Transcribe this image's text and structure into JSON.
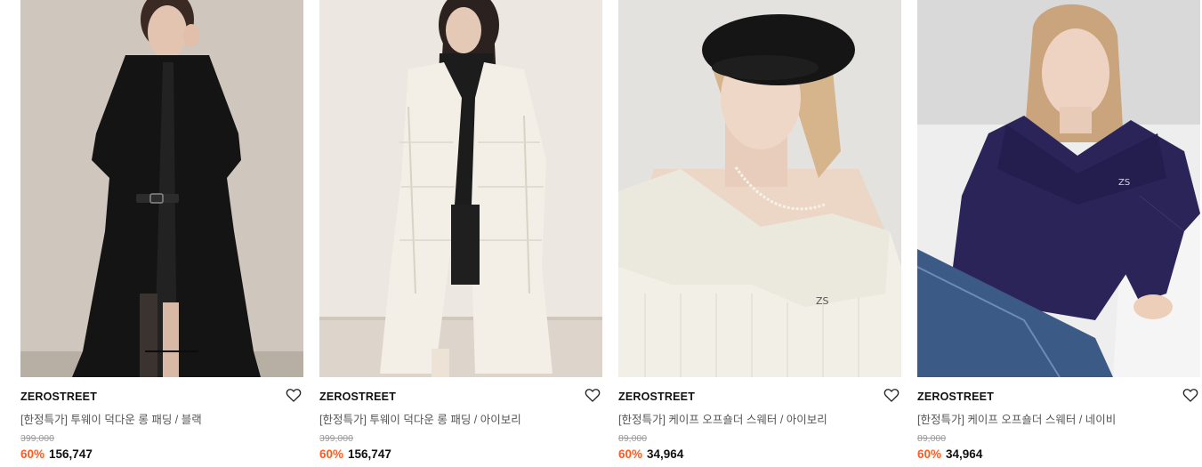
{
  "products": [
    {
      "brand": "ZEROSTREET",
      "name": "[한정특가] 투웨이 덕다운 롱 패딩 / 블랙",
      "original_price": "399,000",
      "discount": "60%",
      "sale_price": "156,747",
      "wishlist_icon": "heart-outline-icon",
      "image": "model-black-long-padding-photo"
    },
    {
      "brand": "ZEROSTREET",
      "name": "[한정특가] 투웨이 덕다운 롱 패딩 / 아이보리",
      "original_price": "399,000",
      "discount": "60%",
      "sale_price": "156,747",
      "wishlist_icon": "heart-outline-icon",
      "image": "model-ivory-long-padding-photo"
    },
    {
      "brand": "ZEROSTREET",
      "name": "[한정특가] 케이프 오프숄더 스웨터 / 아이보리",
      "original_price": "89,000",
      "discount": "60%",
      "sale_price": "34,964",
      "wishlist_icon": "heart-outline-icon",
      "image": "model-ivory-offshoulder-sweater-photo"
    },
    {
      "brand": "ZEROSTREET",
      "name": "[한정특가] 케이프 오프숄더 스웨터 / 네이비",
      "original_price": "89,000",
      "discount": "60%",
      "sale_price": "34,964",
      "wishlist_icon": "heart-outline-icon",
      "image": "model-navy-offshoulder-sweater-photo"
    }
  ],
  "colors": {
    "discount": "#ff5a1f",
    "brand_text": "#111111",
    "name_text": "#555555",
    "original_price_text": "#9b9b9b"
  }
}
